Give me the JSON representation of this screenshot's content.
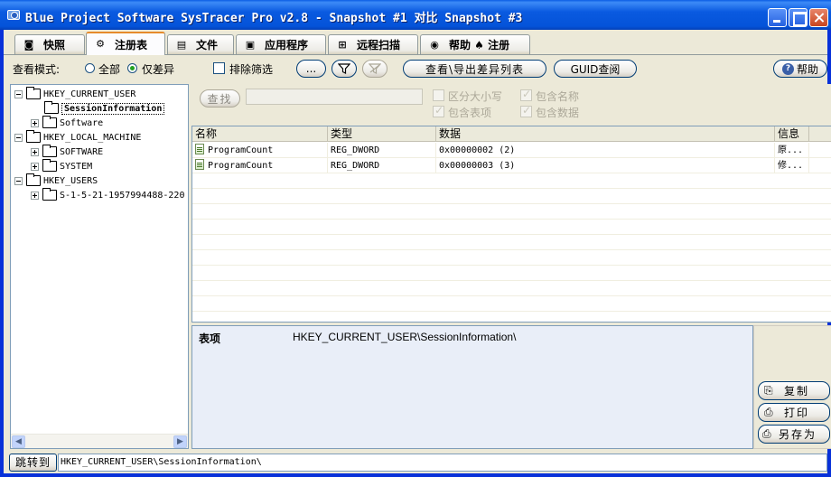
{
  "window": {
    "title": "Blue Project Software SysTracer Pro v2.8 - Snapshot #1 对比 Snapshot #3"
  },
  "tabs": [
    {
      "label": "快照",
      "icon": "camera-icon",
      "active": false
    },
    {
      "label": "注册表",
      "icon": "registry-icon",
      "active": true
    },
    {
      "label": "文件",
      "icon": "file-icon",
      "active": false
    },
    {
      "label": "应用程序",
      "icon": "application-icon",
      "active": false
    },
    {
      "label": "远程扫描",
      "icon": "network-icon",
      "active": false
    },
    {
      "label": "帮助 ♠ 注册",
      "icon": "help-icon",
      "active": false
    }
  ],
  "toolbar": {
    "view_mode_label": "查看模式:",
    "radio_all": "全部",
    "radio_diff": "仅差异",
    "exclude_filter": "排除筛选",
    "more_button": "...",
    "view_export_button": "查看\\导出差异列表",
    "guid_button": "GUID查阅",
    "help_button": "帮助"
  },
  "tree": {
    "nodes": [
      {
        "label": "HKEY_CURRENT_USER",
        "level": 0,
        "expander": "minus"
      },
      {
        "label": "SessionInformation",
        "level": 1,
        "expander": "none",
        "selected": true
      },
      {
        "label": "Software",
        "level": 1,
        "expander": "plus"
      },
      {
        "label": "HKEY_LOCAL_MACHINE",
        "level": 0,
        "expander": "minus"
      },
      {
        "label": "SOFTWARE",
        "level": 1,
        "expander": "plus"
      },
      {
        "label": "SYSTEM",
        "level": 1,
        "expander": "plus"
      },
      {
        "label": "HKEY_USERS",
        "level": 0,
        "expander": "minus"
      },
      {
        "label": "S-1-5-21-1957994488-220",
        "level": 1,
        "expander": "plus"
      }
    ]
  },
  "search": {
    "find_button": "查找",
    "case_sensitive": "区分大小写",
    "include_name": "包含名称",
    "include_entries": "包含表项",
    "include_data": "包含数据"
  },
  "table": {
    "columns": [
      "名称",
      "类型",
      "数据",
      "信息"
    ],
    "rows": [
      {
        "name": "ProgramCount",
        "type": "REG_DWORD",
        "data": "0x00000002 (2)",
        "info": "原..."
      },
      {
        "name": "ProgramCount",
        "type": "REG_DWORD",
        "data": "0x00000003 (3)",
        "info": "修..."
      }
    ]
  },
  "detail": {
    "label": "表项",
    "value": "HKEY_CURRENT_USER\\SessionInformation\\"
  },
  "side_buttons": {
    "copy": "复制",
    "print": "打印",
    "save_as": "另存为"
  },
  "pathbar": {
    "jump_button": "跳转到",
    "path": "HKEY_CURRENT_USER\\SessionInformation\\"
  }
}
